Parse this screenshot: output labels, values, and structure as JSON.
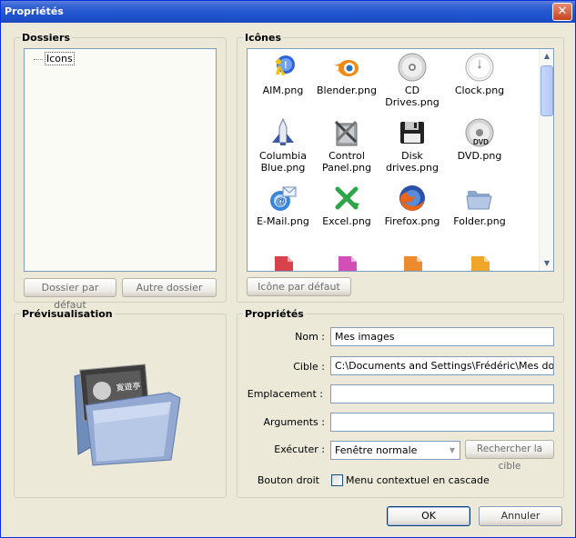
{
  "window": {
    "title": "Propriétés",
    "close_glyph": "✕"
  },
  "dossiers": {
    "legend": "Dossiers",
    "tree_root": "Icons",
    "btn_default": "Dossier par défaut",
    "btn_other": "Autre dossier"
  },
  "icones": {
    "legend": "Icônes",
    "items": [
      {
        "label": "AIM.png",
        "icon": "aim-icon"
      },
      {
        "label": "Blender.png",
        "icon": "blender-icon"
      },
      {
        "label": "CD Drives.png",
        "icon": "cd-drive-icon"
      },
      {
        "label": "Clock.png",
        "icon": "clock-icon"
      },
      {
        "label": "Columbia Blue.png",
        "icon": "shuttle-icon"
      },
      {
        "label": "Control Panel.png",
        "icon": "control-panel-icon"
      },
      {
        "label": "Disk drives.png",
        "icon": "floppy-icon"
      },
      {
        "label": "DVD.png",
        "icon": "dvd-icon"
      },
      {
        "label": "E-Mail.png",
        "icon": "email-icon"
      },
      {
        "label": "Excel.png",
        "icon": "excel-icon"
      },
      {
        "label": "Firefox.png",
        "icon": "firefox-icon"
      },
      {
        "label": "Folder.png",
        "icon": "folder-icon"
      },
      {
        "label": "",
        "icon": "red-doc-icon"
      },
      {
        "label": "",
        "icon": "pink-doc-icon"
      },
      {
        "label": "",
        "icon": "orange-doc-icon"
      },
      {
        "label": "",
        "icon": "yellow-doc-icon"
      }
    ],
    "btn_default": "Icône par défaut"
  },
  "preview": {
    "legend": "Prévisualisation",
    "icon": "folder-images-icon"
  },
  "props": {
    "legend": "Propriétés",
    "nom_label": "Nom :",
    "nom_value": "Mes images",
    "cible_label": "Cible :",
    "cible_value": "C:\\Documents and Settings\\Frédéric\\Mes docume",
    "emplacement_label": "Emplacement :",
    "emplacement_value": "",
    "arguments_label": "Arguments :",
    "arguments_value": "",
    "executer_label": "Exécuter :",
    "executer_value": "Fenêtre normale",
    "btn_search": "Rechercher la cible",
    "bouton_droit_label": "Bouton droit",
    "checkbox_label": "Menu contextuel en cascade",
    "checkbox_checked": false
  },
  "footer": {
    "ok": "OK",
    "cancel": "Annuler"
  }
}
